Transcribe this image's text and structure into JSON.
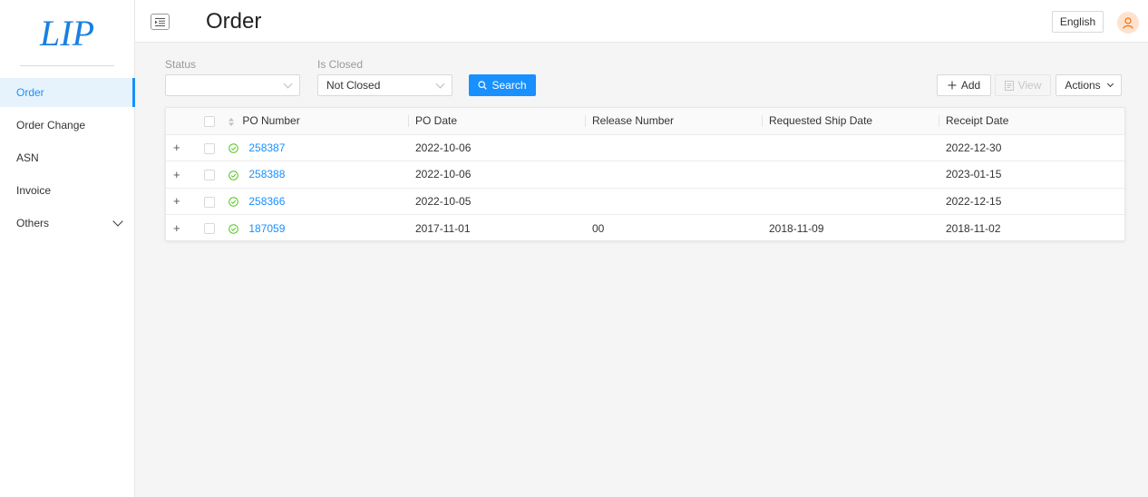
{
  "sidebar": {
    "logo_text": "LIP",
    "items": [
      {
        "label": "Order",
        "active": true
      },
      {
        "label": "Order Change",
        "active": false
      },
      {
        "label": "ASN",
        "active": false
      },
      {
        "label": "Invoice",
        "active": false
      },
      {
        "label": "Others",
        "active": false,
        "expandable": true
      }
    ]
  },
  "header": {
    "title": "Order",
    "language": "English",
    "menu_icon": "menu-fold-icon",
    "avatar_icon": "user-icon"
  },
  "filters": {
    "status": {
      "label": "Status",
      "value": ""
    },
    "is_closed": {
      "label": "Is Closed",
      "value": "Not Closed"
    },
    "search_label": "Search"
  },
  "toolbar": {
    "add_label": "Add",
    "view_label": "View",
    "actions_label": "Actions"
  },
  "table": {
    "columns": [
      "PO Number",
      "PO Date",
      "Release Number",
      "Requested Ship Date",
      "Receipt Date"
    ],
    "rows": [
      {
        "po_number": "258387",
        "po_date": "2022-10-06",
        "release_number": "",
        "requested_ship_date": "",
        "receipt_date": "2022-12-30"
      },
      {
        "po_number": "258388",
        "po_date": "2022-10-06",
        "release_number": "",
        "requested_ship_date": "",
        "receipt_date": "2023-01-15"
      },
      {
        "po_number": "258366",
        "po_date": "2022-10-05",
        "release_number": "",
        "requested_ship_date": "",
        "receipt_date": "2022-12-15"
      },
      {
        "po_number": "187059",
        "po_date": "2017-11-01",
        "release_number": "00",
        "requested_ship_date": "2018-11-09",
        "receipt_date": "2018-11-02"
      }
    ],
    "expand_symbol": "+"
  },
  "colors": {
    "accent": "#1890ff",
    "status_ok": "#52c41a",
    "logo": "#1a7fe0",
    "avatar_bg": "#fde3cf",
    "avatar_fg": "#f56a00"
  }
}
